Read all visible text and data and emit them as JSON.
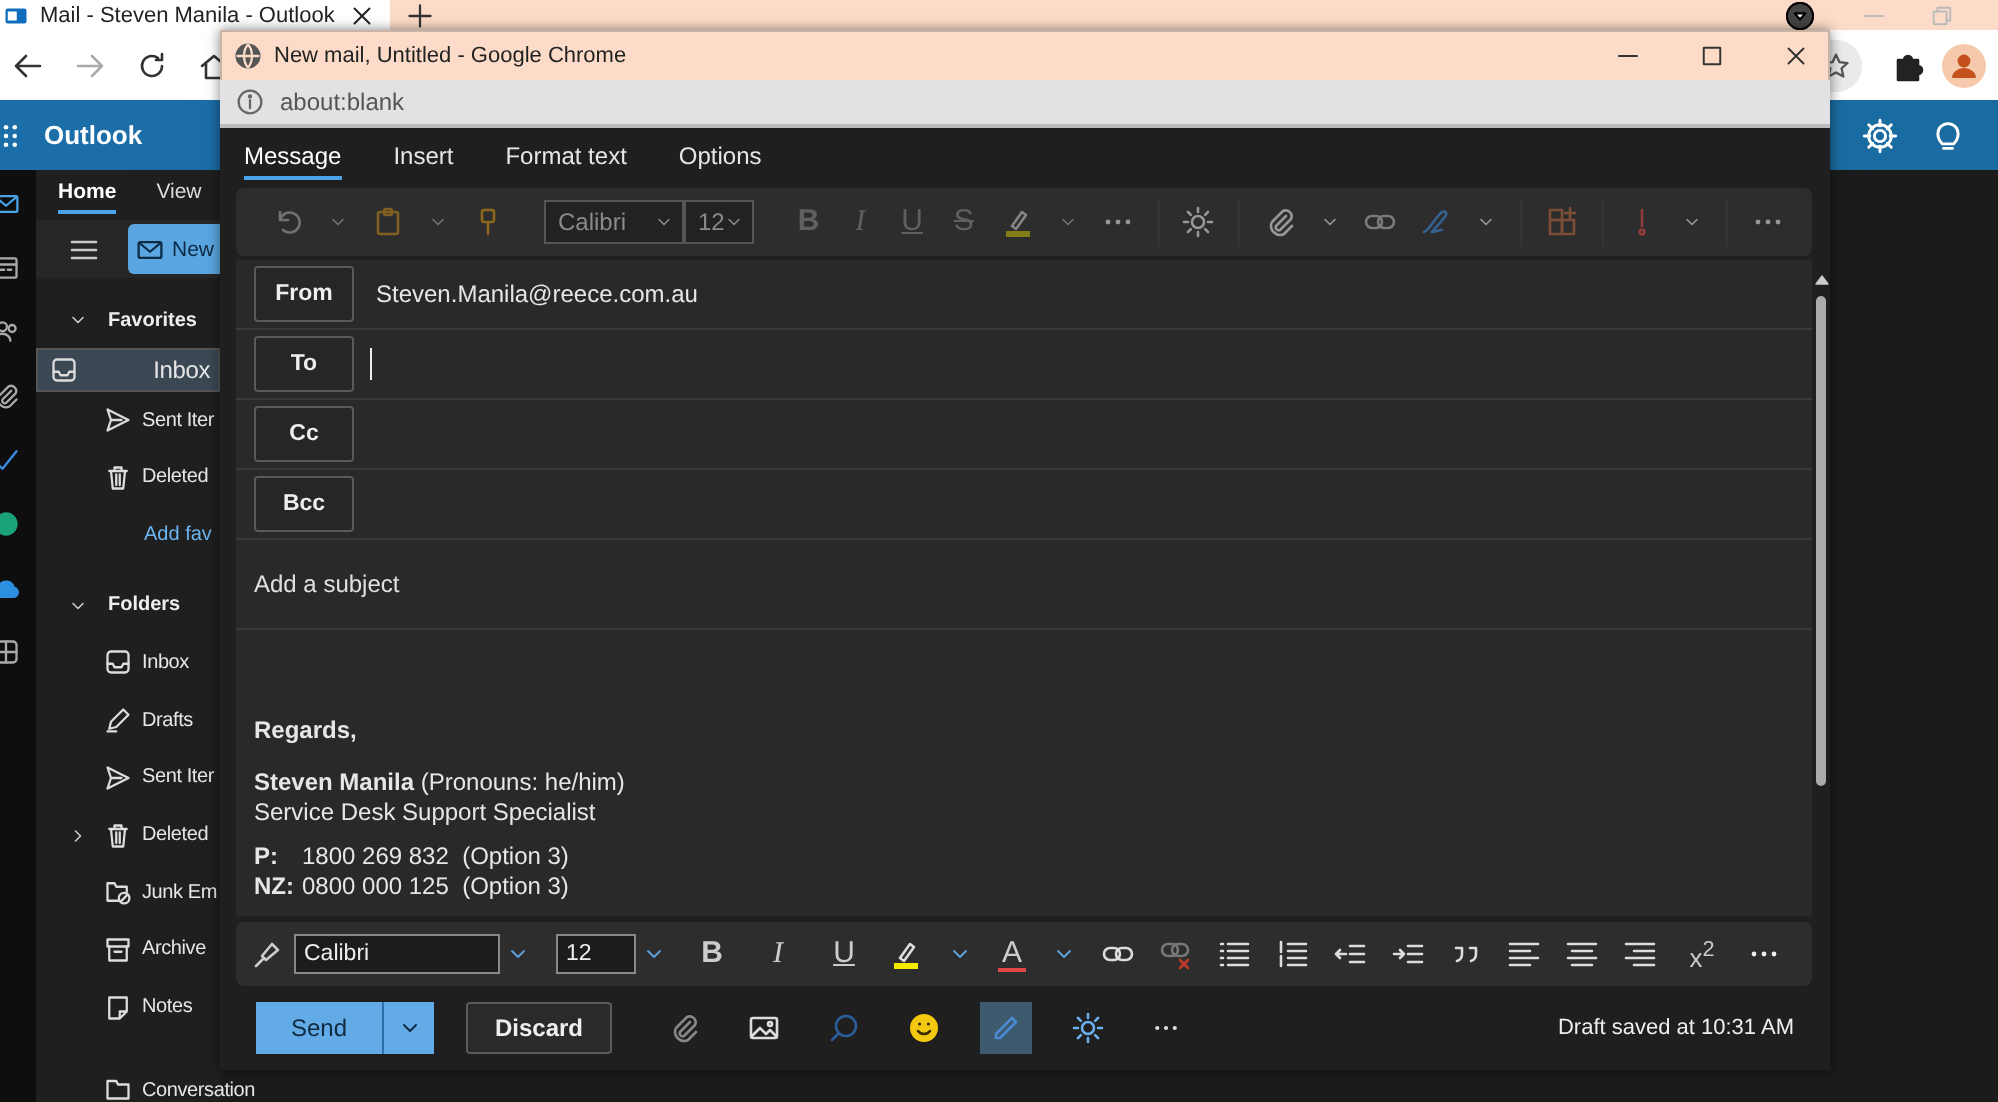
{
  "browser": {
    "tab_title": "Mail - Steven Manila - Outlook"
  },
  "outlook": {
    "app_name": "Outlook",
    "ribbon_tabs": [
      {
        "label": "Home",
        "selected": true
      },
      {
        "label": "View",
        "selected": false
      }
    ],
    "new_button": "New",
    "sections": [
      {
        "label": "Favorites",
        "expanded": true,
        "items": [
          {
            "kind": "folder",
            "label": "Inbox",
            "selected": true,
            "expandable": false
          },
          {
            "kind": "folder",
            "label": "Sent Iter",
            "selected": false,
            "expandable": false
          },
          {
            "kind": "folder",
            "label": "Deleted",
            "selected": false,
            "expandable": false
          },
          {
            "kind": "link",
            "label": "Add fav"
          }
        ]
      },
      {
        "label": "Folders",
        "expanded": true,
        "items": [
          {
            "kind": "folder",
            "label": "Inbox",
            "selected": false,
            "expandable": false
          },
          {
            "kind": "folder",
            "label": "Drafts",
            "selected": false,
            "expandable": false
          },
          {
            "kind": "folder",
            "label": "Sent Iter",
            "selected": false,
            "expandable": false
          },
          {
            "kind": "folder",
            "label": "Deleted",
            "selected": false,
            "expandable": true
          },
          {
            "kind": "folder",
            "label": "Junk Em",
            "selected": false,
            "expandable": false
          },
          {
            "kind": "folder",
            "label": "Archive",
            "selected": false,
            "expandable": false
          },
          {
            "kind": "folder",
            "label": "Notes",
            "selected": false,
            "expandable": false
          },
          {
            "kind": "folder",
            "label": "Conversation",
            "selected": false,
            "expandable": false
          }
        ]
      }
    ]
  },
  "popup": {
    "title": "New mail, Untitled - Google Chrome",
    "address": "about:blank"
  },
  "compose": {
    "tabs": [
      {
        "label": "Message",
        "selected": true
      },
      {
        "label": "Insert",
        "selected": false
      },
      {
        "label": "Format text",
        "selected": false
      },
      {
        "label": "Options",
        "selected": false
      }
    ],
    "ribbon": {
      "disabled": true,
      "font": "Calibri",
      "size": "12",
      "bold": "B",
      "italic": "I",
      "underline": "U",
      "strike": "S"
    },
    "from": {
      "label": "From",
      "value": "Steven.Manila@reece.com.au"
    },
    "recipients": [
      {
        "label": "To",
        "focused": true
      },
      {
        "label": "Cc",
        "focused": false
      },
      {
        "label": "Bcc",
        "focused": false
      }
    ],
    "subject": {
      "placeholder": "Add a subject"
    },
    "signature": {
      "greeting": "Regards,",
      "name_line": "**Steven Manila** (Pronouns: he/him)",
      "title": "Service Desk Support Specialist",
      "phones": [
        {
          "label": "P:",
          "number": "1800 269 832  (Option 3)"
        },
        {
          "label": "NZ:",
          "number": "0800 000 125  (Option 3)"
        }
      ]
    },
    "format_bar": {
      "font": "Calibri",
      "size": "12",
      "bold": "B",
      "italic": "I",
      "underline": "U",
      "font_color": "A",
      "superscript": "x$^{2}$"
    },
    "actions": {
      "send": "Send",
      "discard": "Discard",
      "editor_on": true,
      "status": "Draft saved at 10:31 AM"
    }
  }
}
